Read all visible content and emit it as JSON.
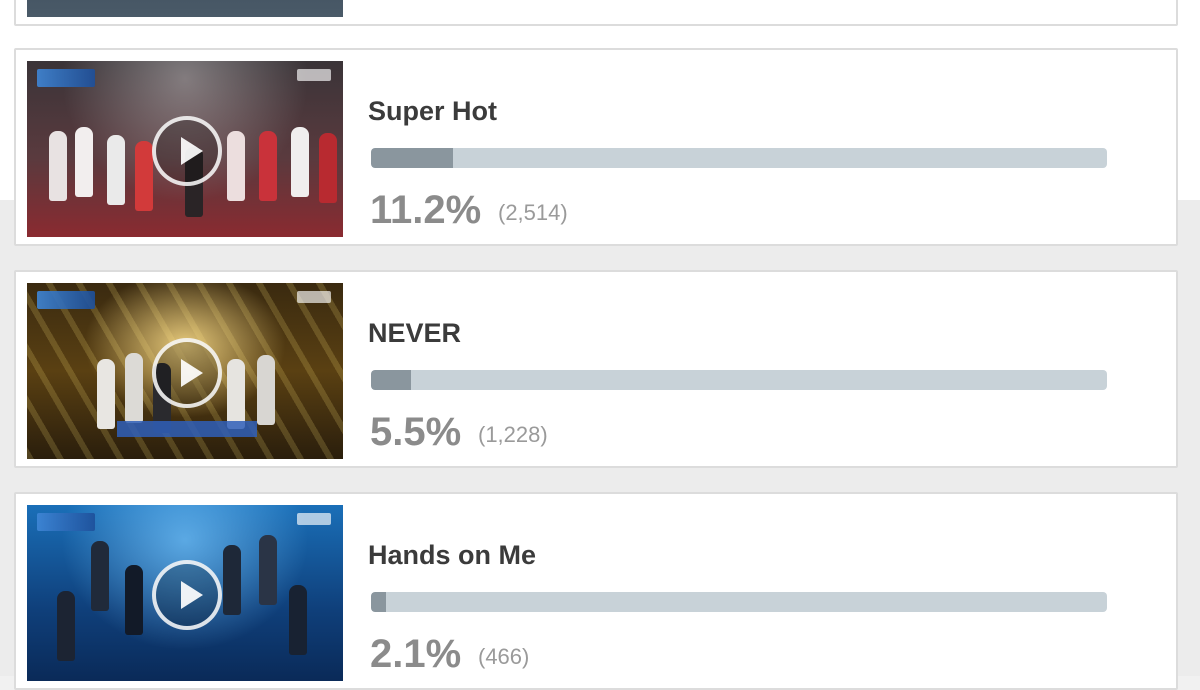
{
  "items": [
    {
      "title": "Super Hot",
      "percent": "11.2%",
      "count": "(2,514)",
      "share": 0.112
    },
    {
      "title": "NEVER",
      "percent": "5.5%",
      "count": "(1,228)",
      "share": 0.055
    },
    {
      "title": "Hands on Me",
      "percent": "2.1%",
      "count": "(466)",
      "share": 0.021
    }
  ],
  "colors": {
    "bar_track": "#c8d2d8",
    "bar_fill": "#8a969e",
    "title": "#3b3b3b",
    "percent": "#8b8b8b"
  }
}
